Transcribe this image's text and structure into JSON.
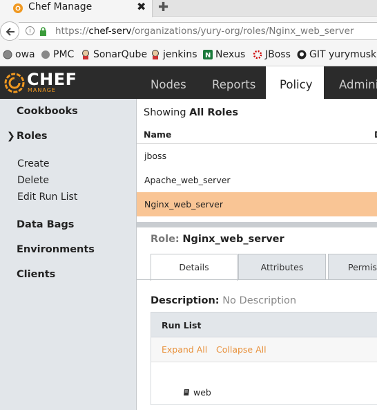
{
  "browser": {
    "tab_title": "Chef Manage",
    "close_glyph": "✖",
    "new_tab_glyph": "✚",
    "url_prefix": "https://",
    "url_host": "chef-serv",
    "url_path": "/organizations/yury-org/roles/Nginx_web_server"
  },
  "bookmarks": [
    {
      "label": "owa",
      "icon": "globe-icon"
    },
    {
      "label": "PMC",
      "icon": "globe-icon"
    },
    {
      "label": "SonarQube",
      "icon": "jenkins-icon"
    },
    {
      "label": "jenkins",
      "icon": "jenkins-icon"
    },
    {
      "label": "Nexus",
      "icon": "nexus-icon"
    },
    {
      "label": "JBoss",
      "icon": "jboss-icon"
    },
    {
      "label": "GIT yurymuski",
      "icon": "github-icon"
    }
  ],
  "chef": {
    "logo_main": "CHEF",
    "logo_sub": "MANAGE",
    "nav": [
      "Nodes",
      "Reports",
      "Policy",
      "Adminis"
    ],
    "active_nav": "Policy",
    "accent": "#f09820"
  },
  "sidebar": {
    "cookbooks": "Cookbooks",
    "roles": "Roles",
    "roles_chevron": "❯",
    "create": "Create",
    "delete": "Delete",
    "edit_run_list": "Edit Run List",
    "data_bags": "Data Bags",
    "environments": "Environments",
    "clients": "Clients"
  },
  "list": {
    "showing_prefix": "Showing",
    "showing_bold": "All Roles",
    "col_name": "Name",
    "col_trunc": "D",
    "rows": [
      "jboss",
      "Apache_web_server",
      "Nginx_web_server"
    ],
    "selected_row": "Nginx_web_server",
    "selected_color": "#f9c595"
  },
  "detail": {
    "role_key": "Role:",
    "role_name": "Nginx_web_server",
    "tabs": [
      "Details",
      "Attributes",
      "Permiss"
    ],
    "active_tab": "Details",
    "desc_key": "Description:",
    "desc_value": "No Description",
    "run_list_title": "Run List",
    "expand_all": "Expand All",
    "collapse_all": "Collapse All",
    "run_list_items": [
      "web"
    ]
  }
}
